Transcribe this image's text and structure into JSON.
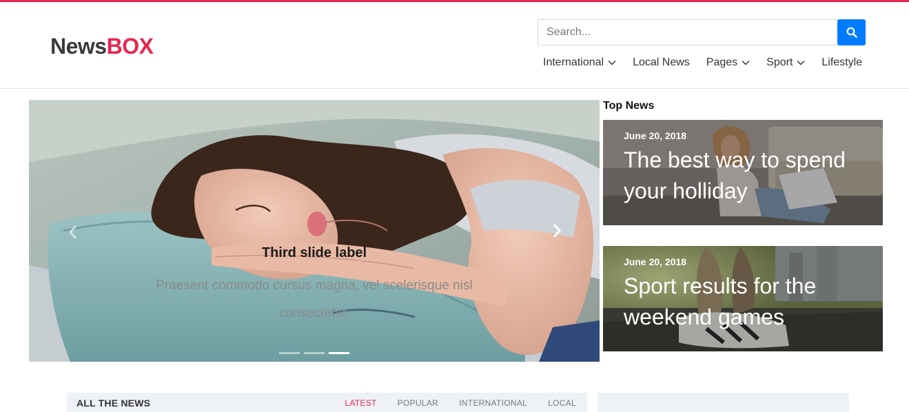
{
  "brand": {
    "name_part1": "News",
    "name_part2": "BOX",
    "accent_color": "#e8254f"
  },
  "search": {
    "placeholder": "Search...",
    "button_icon": "search-icon",
    "button_color": "#007bff"
  },
  "nav": {
    "items": [
      {
        "label": "International",
        "has_dropdown": true
      },
      {
        "label": "Local News",
        "has_dropdown": false
      },
      {
        "label": "Pages",
        "has_dropdown": true
      },
      {
        "label": "Sport",
        "has_dropdown": true
      },
      {
        "label": "Lifestyle",
        "has_dropdown": false
      }
    ]
  },
  "carousel": {
    "caption_title": "Third slide label",
    "caption_text": "Praesent commodo cursus magna, vel scelerisque nisl consectetur.",
    "slide_count": 3,
    "active_slide": 3,
    "prev_icon": "chevron-left-icon",
    "next_icon": "chevron-right-icon"
  },
  "top_news": {
    "heading": "Top News",
    "cards": [
      {
        "date": "June 20, 2018",
        "headline": "The best way to spend your holliday"
      },
      {
        "date": "June 20, 2018",
        "headline": "Sport results for the weekend games"
      }
    ]
  },
  "all_news": {
    "title": "ALL THE NEWS",
    "tabs": [
      {
        "label": "LATEST",
        "active": true
      },
      {
        "label": "POPULAR",
        "active": false
      },
      {
        "label": "INTERNATIONAL",
        "active": false
      },
      {
        "label": "LOCAL",
        "active": false
      }
    ]
  }
}
